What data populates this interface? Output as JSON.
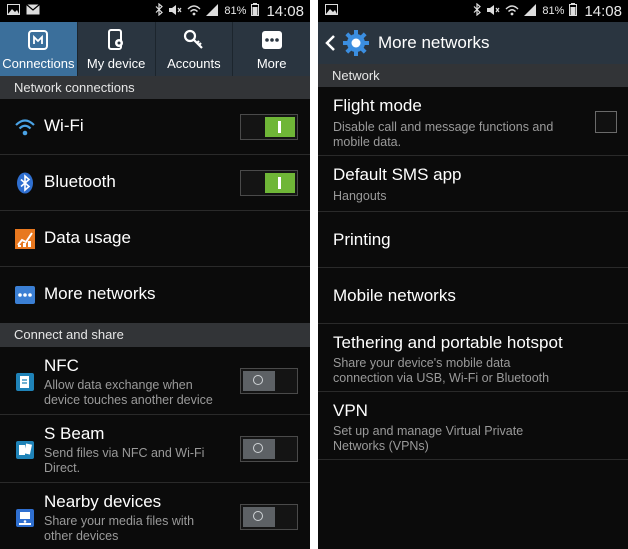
{
  "status_bar": {
    "battery": "81%",
    "time": "14:08"
  },
  "left": {
    "tabs": [
      {
        "label": "Connections",
        "icon": "connections-icon"
      },
      {
        "label": "My device",
        "icon": "my-device-icon"
      },
      {
        "label": "Accounts",
        "icon": "accounts-key-icon"
      },
      {
        "label": "More",
        "icon": "more-dots-icon"
      }
    ],
    "sections": {
      "network": "Network connections",
      "share": "Connect and share"
    },
    "items": {
      "wifi": {
        "label": "Wi-Fi"
      },
      "bluetooth": {
        "label": "Bluetooth"
      },
      "data_usage": {
        "label": "Data usage"
      },
      "more_networks": {
        "label": "More networks"
      },
      "nfc": {
        "label": "NFC",
        "sub": "Allow data exchange when device touches another device"
      },
      "sbeam": {
        "label": "S Beam",
        "sub": "Send files via NFC and Wi-Fi Direct."
      },
      "nearby": {
        "label": "Nearby devices",
        "sub": "Share your media files with other devices"
      }
    },
    "toggles": {
      "wifi": "on",
      "bluetooth": "on",
      "nfc": "off",
      "sbeam": "off",
      "nearby": "off"
    }
  },
  "right": {
    "title": "More networks",
    "section": "Network",
    "items": {
      "flight": {
        "label": "Flight mode",
        "sub": "Disable call and message functions and mobile data."
      },
      "sms": {
        "label": "Default SMS app",
        "sub": "Hangouts"
      },
      "printing": {
        "label": "Printing"
      },
      "mobile": {
        "label": "Mobile networks"
      },
      "tether": {
        "label": "Tethering and portable hotspot",
        "sub": "Share your device's mobile data connection via USB, Wi-Fi or Bluetooth"
      },
      "vpn": {
        "label": "VPN",
        "sub": "Set up and manage Virtual Private Networks (VPNs)"
      }
    },
    "flight_mode_checked": false
  },
  "colors": {
    "accent_tab": "#3b6f9b",
    "toolbar": "#2a3540",
    "toggle_on": "#6fb637"
  }
}
